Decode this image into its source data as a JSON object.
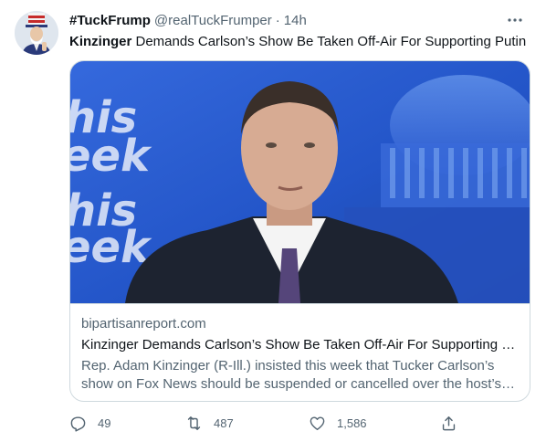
{
  "tweet": {
    "display_name": "#TuckFrump",
    "handle": "@realTuckFrumper",
    "separator": "·",
    "timestamp": "14h",
    "text_bold": "Kinzinger",
    "text_rest": " Demands Carlson’s Show Be Taken Off-Air For Supporting Putin"
  },
  "card": {
    "domain": "bipartisanreport.com",
    "title": "Kinzinger Demands Carlson’s Show Be Taken Off-Air For Supporting Putin",
    "description": "Rep. Adam Kinzinger (R-Ill.) insisted this week that Tucker Carlson’s show on Fox News should be suspended or cancelled over the host’s views on Putin and Russia",
    "image_text_top": "his",
    "image_text_bottom": "eek"
  },
  "actions": {
    "reply_count": "49",
    "retweet_count": "487",
    "like_count": "1,586"
  },
  "icons": {
    "more": "more-horizontal-icon",
    "reply": "reply-icon",
    "retweet": "retweet-icon",
    "like": "heart-icon",
    "share": "share-icon"
  },
  "colors": {
    "text_primary": "#0f1419",
    "text_secondary": "#536471",
    "border": "#cfd9de",
    "background_blue": "#1b4fc6"
  }
}
